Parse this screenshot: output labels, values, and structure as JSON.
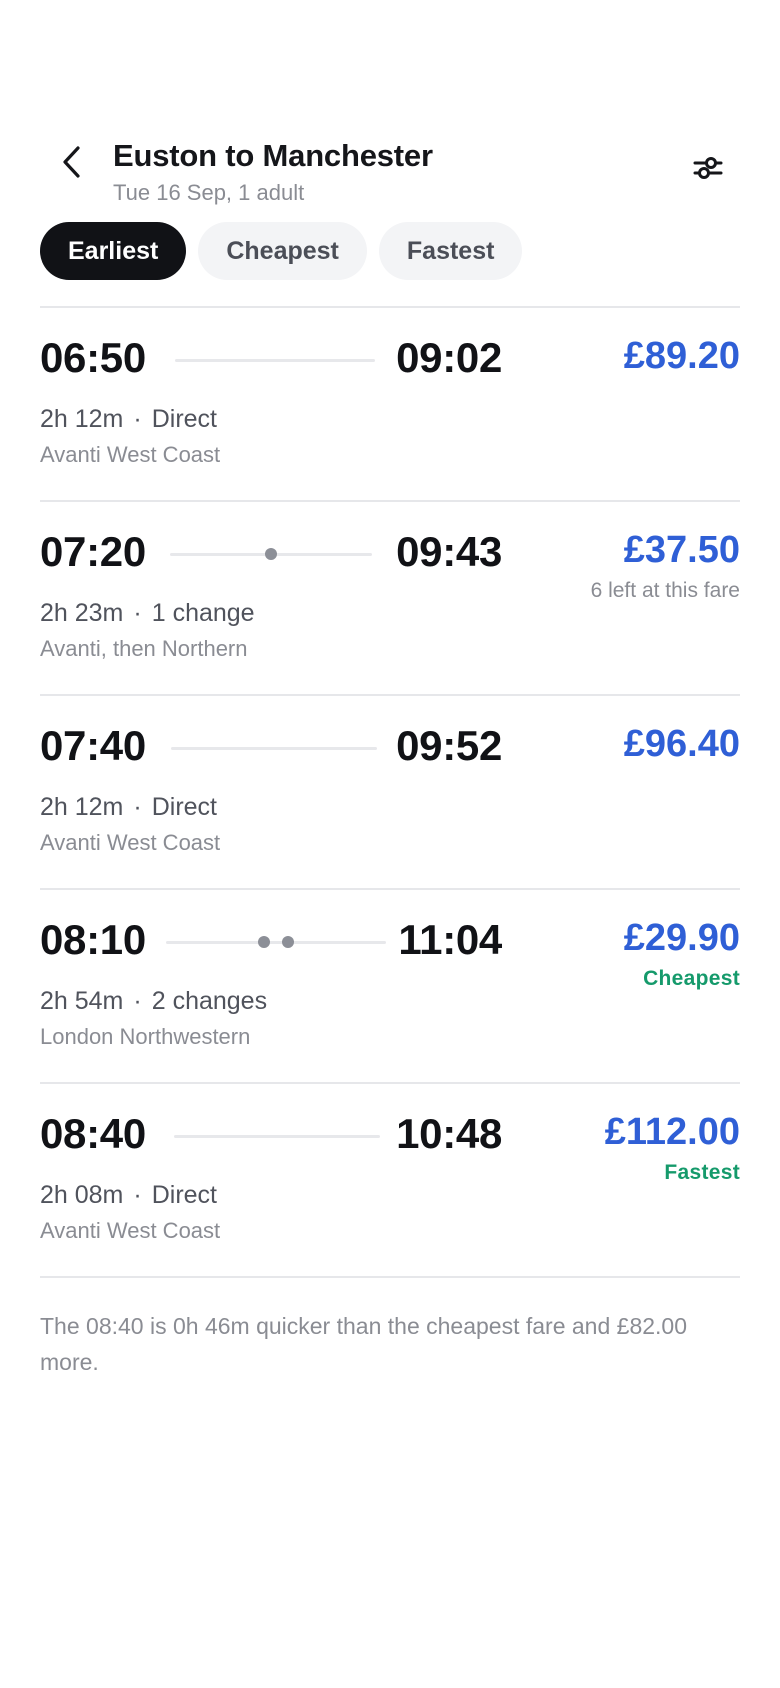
{
  "header": {
    "title": "Euston to Manchester",
    "subtitle": "Tue 16 Sep, 1 adult"
  },
  "sort_chips": [
    {
      "label": "Earliest",
      "active": true
    },
    {
      "label": "Cheapest",
      "active": false
    },
    {
      "label": "Fastest",
      "active": false
    }
  ],
  "journeys": [
    {
      "depart": "06:50",
      "arrive": "09:02",
      "duration": "2h 12m",
      "separator": "·",
      "changes": "Direct",
      "change_count": 0,
      "operator": "Avanti West Coast",
      "price": "£89.20",
      "note": "",
      "badge": ""
    },
    {
      "depart": "07:20",
      "arrive": "09:43",
      "duration": "2h 23m",
      "separator": "·",
      "changes": "1 change",
      "change_count": 1,
      "operator": "Avanti, then Northern",
      "price": "£37.50",
      "note": "6 left at this fare",
      "badge": ""
    },
    {
      "depart": "07:40",
      "arrive": "09:52",
      "duration": "2h 12m",
      "separator": "·",
      "changes": "Direct",
      "change_count": 0,
      "operator": "Avanti West Coast",
      "price": "£96.40",
      "note": "",
      "badge": ""
    },
    {
      "depart": "08:10",
      "arrive": "11:04",
      "duration": "2h 54m",
      "separator": "·",
      "changes": "2 changes",
      "change_count": 2,
      "operator": "London Northwestern",
      "price": "£29.90",
      "note": "",
      "badge": "Cheapest"
    },
    {
      "depart": "08:40",
      "arrive": "10:48",
      "duration": "2h 08m",
      "separator": "·",
      "changes": "Direct",
      "change_count": 0,
      "operator": "Avanti West Coast",
      "price": "£112.00",
      "note": "",
      "badge": "Fastest"
    }
  ],
  "footnote": "The 08:40 is 0h 46m quicker than the cheapest fare and £82.00 more.",
  "colors": {
    "price": "#2f5fd6",
    "badge": "#159a6b",
    "chip_active_bg": "#111216",
    "chip_bg": "#f3f4f6"
  },
  "icons": {
    "back": "chevron-left-icon",
    "filter": "sliders-icon"
  }
}
